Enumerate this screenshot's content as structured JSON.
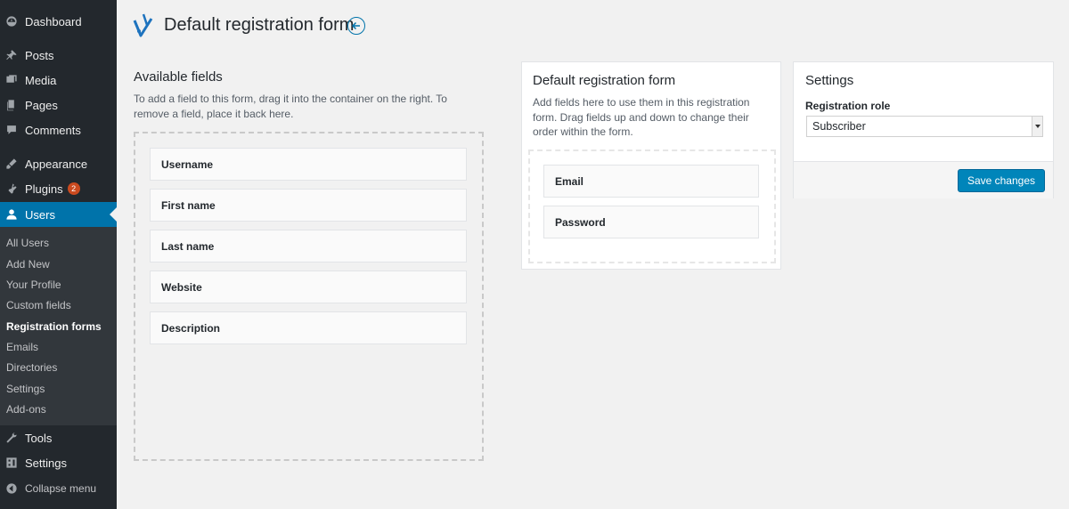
{
  "sidebar": {
    "items": [
      {
        "label": "Dashboard",
        "icon": "dashboard-icon"
      },
      {
        "label": "Posts",
        "icon": "pin-icon"
      },
      {
        "label": "Media",
        "icon": "media-icon"
      },
      {
        "label": "Pages",
        "icon": "pages-icon"
      },
      {
        "label": "Comments",
        "icon": "comments-icon"
      },
      {
        "label": "Appearance",
        "icon": "appearance-icon"
      },
      {
        "label": "Plugins",
        "icon": "plugins-icon",
        "badge": "2"
      },
      {
        "label": "Users",
        "icon": "users-icon",
        "active": true
      },
      {
        "label": "Tools",
        "icon": "tools-icon"
      },
      {
        "label": "Settings",
        "icon": "settings-icon"
      }
    ],
    "submenu": [
      "All Users",
      "Add New",
      "Your Profile",
      "Custom fields",
      "Registration forms",
      "Emails",
      "Directories",
      "Settings",
      "Add-ons"
    ],
    "current_submenu": "Registration forms",
    "collapse_label": "Collapse menu"
  },
  "header": {
    "title": "Default registration form"
  },
  "available": {
    "title": "Available fields",
    "description": "To add a field to this form, drag it into the container on the right. To remove a field, place it back here.",
    "fields": [
      "Username",
      "First name",
      "Last name",
      "Website",
      "Description"
    ]
  },
  "form": {
    "title": "Default registration form",
    "description": "Add fields here to use them in this registration form. Drag fields up and down to change their order within the form.",
    "fields": [
      "Email",
      "Password"
    ]
  },
  "settings": {
    "title": "Settings",
    "role_label": "Registration role",
    "role_value": "Subscriber",
    "save_label": "Save changes"
  },
  "colors": {
    "sidebar_bg": "#23282d",
    "submenu_bg": "#32373c",
    "accent": "#0073aa",
    "button": "#0085ba",
    "badge": "#ca4a1f"
  }
}
